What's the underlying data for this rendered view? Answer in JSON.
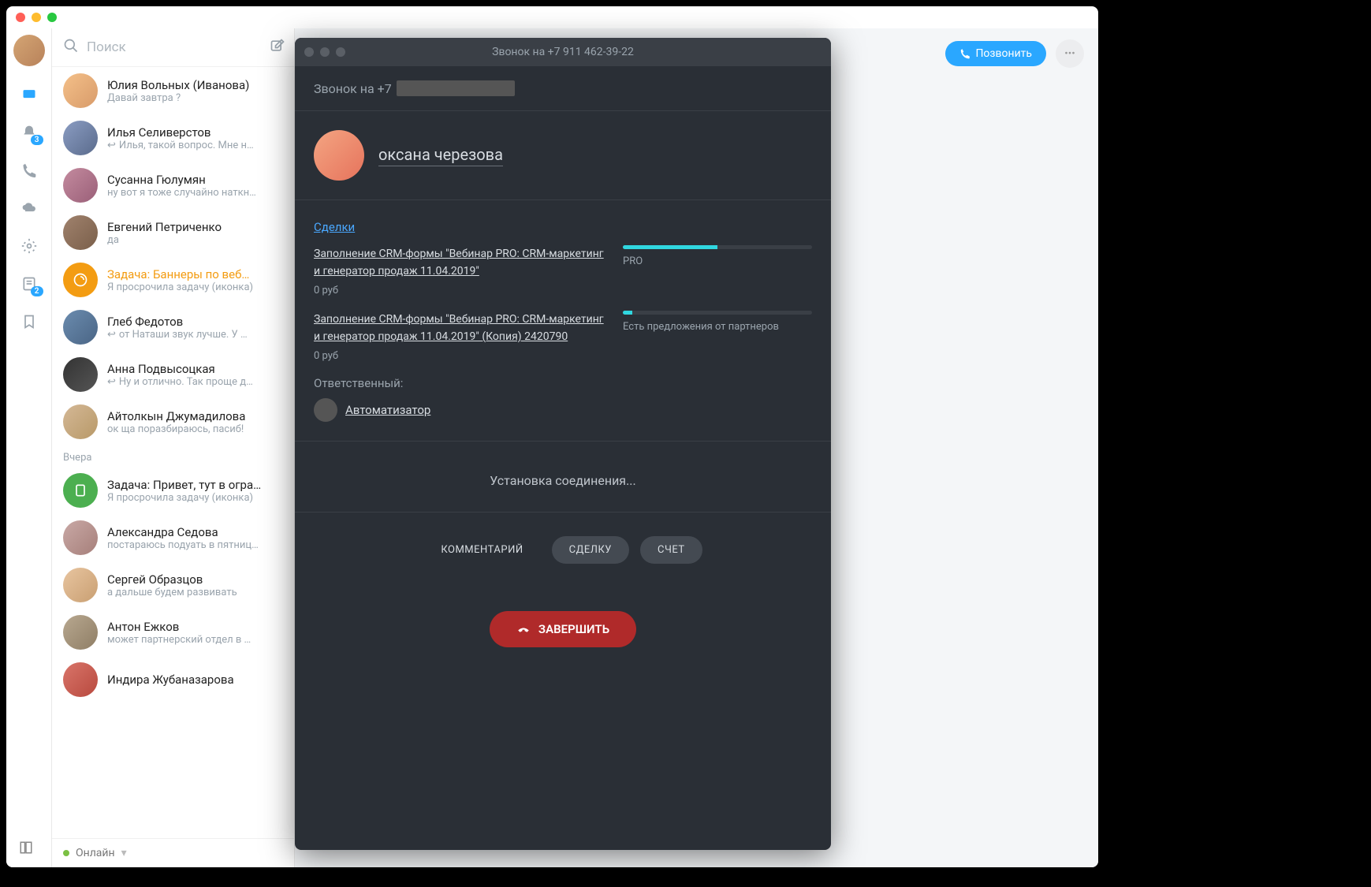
{
  "search": {
    "placeholder": "Поиск"
  },
  "rail": {
    "contacts_badge": "3",
    "notes_badge": "2"
  },
  "contacts": [
    {
      "name": "Юлия Вольных (Иванова)",
      "sub": "Давай завтра ?",
      "avatar": "photo",
      "sub_prefix": ""
    },
    {
      "name": "Илья Селиверстов",
      "sub": "Илья, такой вопрос. Мне н…",
      "avatar": "photo",
      "sub_prefix": "reply"
    },
    {
      "name": "Сусанна Гюлумян",
      "sub": "ну вот я тоже случайно наткн…",
      "avatar": "photo",
      "sub_prefix": ""
    },
    {
      "name": "Евгений Петриченко",
      "sub": "да",
      "avatar": "photo",
      "sub_prefix": ""
    },
    {
      "name": "Задача: Баннеры по веб…",
      "sub": "Я просрочила задачу (иконка)",
      "avatar": "orange",
      "sub_prefix": "",
      "name_class": "orange"
    },
    {
      "name": "Глеб Федотов",
      "sub": "от Наташи звук лучше. У …",
      "avatar": "photo",
      "sub_prefix": "reply"
    },
    {
      "name": "Анна Подвысоцкая",
      "sub": "Ну и отлично. Так проще д…",
      "avatar": "photo",
      "sub_prefix": "reply"
    },
    {
      "name": "Айтолкын Джумадилова",
      "sub": "ок ща поразбираюсь, пасиб!",
      "avatar": "photo",
      "sub_prefix": ""
    }
  ],
  "section_label": "Вчера",
  "contacts2": [
    {
      "name": "Задача: Привет, тут в огра…",
      "sub": "Я просрочила задачу (иконка)",
      "avatar": "green"
    },
    {
      "name": "Александра Седова",
      "sub": "постараюсь подуать в пятниц…",
      "avatar": "photo"
    },
    {
      "name": "Сергей Образцов",
      "sub": "а дальше будем развивать",
      "avatar": "photo"
    },
    {
      "name": "Антон Ежков",
      "sub": "может партнерский отдел в …",
      "avatar": "photo"
    },
    {
      "name": "Индира Жубаназарова",
      "sub": "",
      "avatar": "photo"
    }
  ],
  "status": {
    "label": "Онлайн"
  },
  "right_top": {
    "call_label": "Позвонить"
  },
  "call_window": {
    "title": "Звонок на +7 911 462-39-22",
    "header_prefix": "Звонок на +7",
    "caller_name": "оксана черезова",
    "deals_title": "Сделки",
    "deals": [
      {
        "link": "Заполнение CRM-формы \"Вебинар PRO: CRM-маркетинг и генератор продаж 11.04.2019\"",
        "price": "0 руб",
        "progress": 50,
        "stage": "PRO"
      },
      {
        "link": "Заполнение CRM-формы \"Вебинар PRO: CRM-маркетинг и генератор продаж 11.04.2019\" (Копия) 2420790",
        "price": "0 руб",
        "progress": 5,
        "stage": "Есть предложения от партнеров"
      }
    ],
    "responsible_label": "Ответственный:",
    "responsible_name": "Автоматизатор",
    "connecting": "Установка соединения...",
    "actions": {
      "comment": "КОММЕНТАРИЙ",
      "deal": "СДЕЛКУ",
      "invoice": "СЧЕТ"
    },
    "end_call": "ЗАВЕРШИТЬ"
  }
}
